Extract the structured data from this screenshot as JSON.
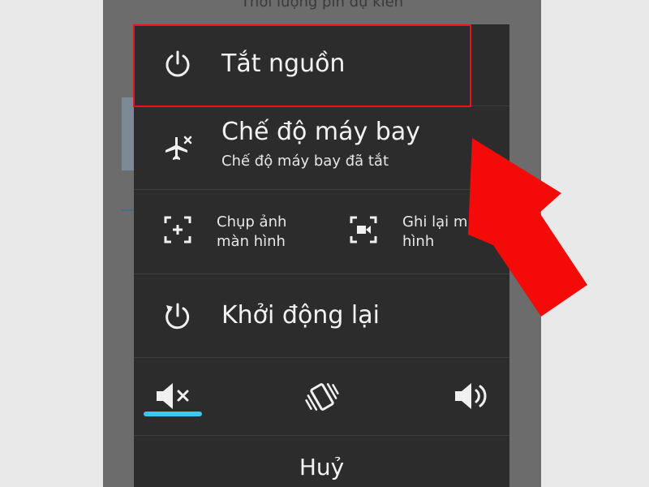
{
  "background": {
    "partial_text": "Thời lượng pin dự kiến"
  },
  "menu": {
    "power_off": {
      "label": "Tắt nguồn",
      "icon": "power-icon"
    },
    "airplane": {
      "label": "Chế độ máy bay",
      "status": "Chế độ máy bay đã tắt",
      "icon": "airplane-off-icon"
    },
    "screenshot": {
      "line1": "Chụp ảnh",
      "line2": "màn hình",
      "icon": "screenshot-icon"
    },
    "screen_record": {
      "line1": "Ghi lại m",
      "line2": "hình",
      "icon": "screen-record-icon"
    },
    "restart": {
      "label": "Khởi động lại",
      "icon": "restart-icon"
    },
    "sound_modes": {
      "items": [
        "mute-icon",
        "vibrate-icon",
        "volume-on-icon"
      ],
      "selected": "mute-icon"
    },
    "cancel": {
      "label": "Huỷ"
    }
  },
  "colors": {
    "highlight": "#e8151d",
    "arrow": "#f50a0a",
    "accent": "#3cc7f0"
  }
}
